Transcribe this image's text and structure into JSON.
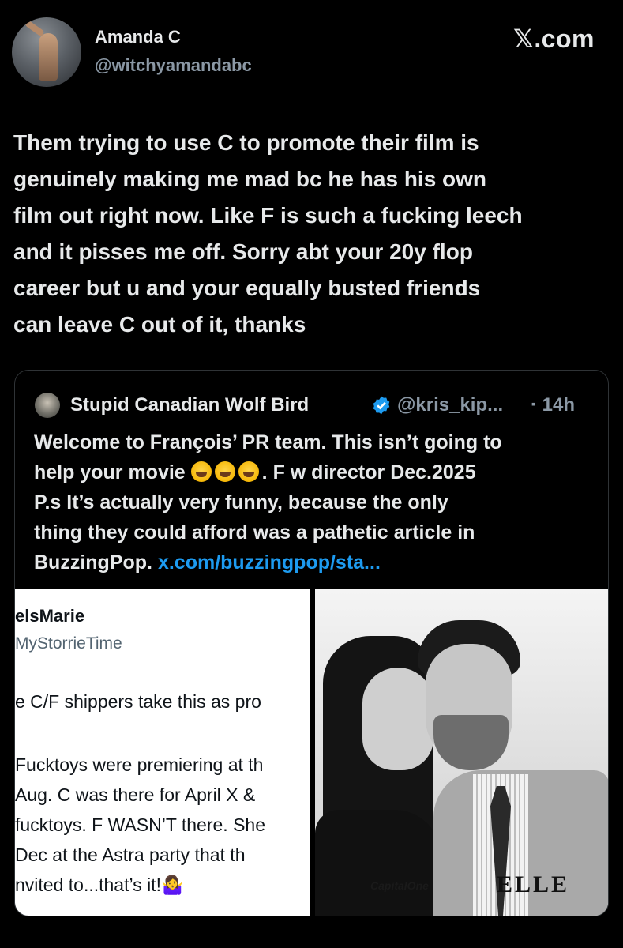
{
  "author": {
    "display_name": "Amanda C",
    "handle": "@witchyamandabc"
  },
  "brand": "𝕏.com",
  "tweet": {
    "lines": [
      "Them trying to use C to promote their film is",
      "genuinely making me mad bc he has his own",
      "film out right now. Like F is such a fucking leech",
      "and it pisses me off.  Sorry abt your 20y flop",
      "career but u and your equally busted friends",
      "can leave C out of it, thanks"
    ]
  },
  "quote": {
    "display_name": "Stupid Canadian Wolf Bird",
    "handle": "@kris_kip...",
    "time": "· 14h",
    "line1": "Welcome to François’ PR team. This isn’t going to",
    "line2_start": "help your movie",
    "line2_end": ". F w director Dec.2025",
    "line3": "P.s It’s actually very funny, because the only",
    "line4": "thing they could afford was a pathetic article in",
    "line5_text": "BuzzingPop.",
    "link": "x.com/buzzingpop/sta..."
  },
  "media": {
    "screenshot": {
      "name": "elsMarie",
      "handle": "MyStorrieTime",
      "lines": [
        "e C/F shippers take this as pro",
        "Fucktoys were premiering at th",
        " Aug. C was there for April X &",
        "fucktoys. F WASN’T there. She",
        " Dec at the Astra party that th",
        "nvited to...that’s it!🤷‍♀️"
      ]
    },
    "photo": {
      "logo_left": "CapitalOne",
      "logo_right": "ELLE"
    }
  },
  "colors": {
    "background": "#000000",
    "text": "#e7e9ea",
    "secondary": "#8b98a5",
    "link": "#1d9bf0",
    "border": "#2f3336"
  }
}
